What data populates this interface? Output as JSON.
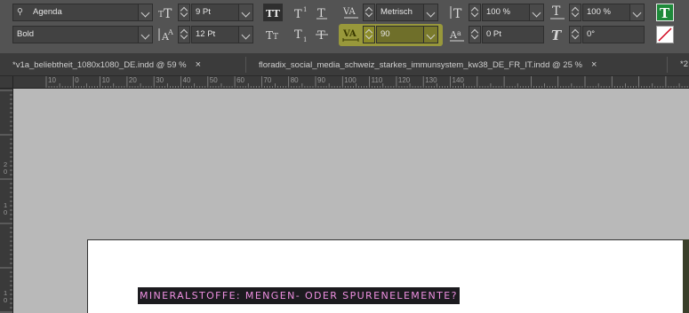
{
  "control_bar": {
    "font_family": "Agenda",
    "font_style": "Bold",
    "font_size": "9 Pt",
    "leading": "12 Pt",
    "kerning_method": "Metrisch",
    "tracking": "90",
    "vertical_scale": "100 %",
    "horizontal_scale": "100 %",
    "baseline_shift": "0 Pt",
    "skew": "0°",
    "highlight_color": "#d2d228"
  },
  "tabs": [
    {
      "label": "*v1a_beliebtheit_1080x1080_DE.indd @ 59 %",
      "close": "×"
    },
    {
      "label": "floradix_social_media_schweiz_starkes_immunsystem_kw38_DE_FR_IT.indd @ 25 %",
      "close": "×"
    },
    {
      "label": "*2",
      "close": ""
    }
  ],
  "ruler": {
    "h_labels": [
      "10",
      "0",
      "10",
      "20",
      "30",
      "40",
      "50",
      "60",
      "70",
      "80",
      "90",
      "100",
      "110",
      "120",
      "130",
      "140"
    ],
    "v_labels": [
      "2 0",
      "1 0",
      "1 0"
    ]
  },
  "document": {
    "heading": "MINERALSTOFFE: MENGEN- ODER SPURENELEMENTE?",
    "heading_color": "#ed8fe0",
    "heading_bg": "#1c1b1f"
  }
}
